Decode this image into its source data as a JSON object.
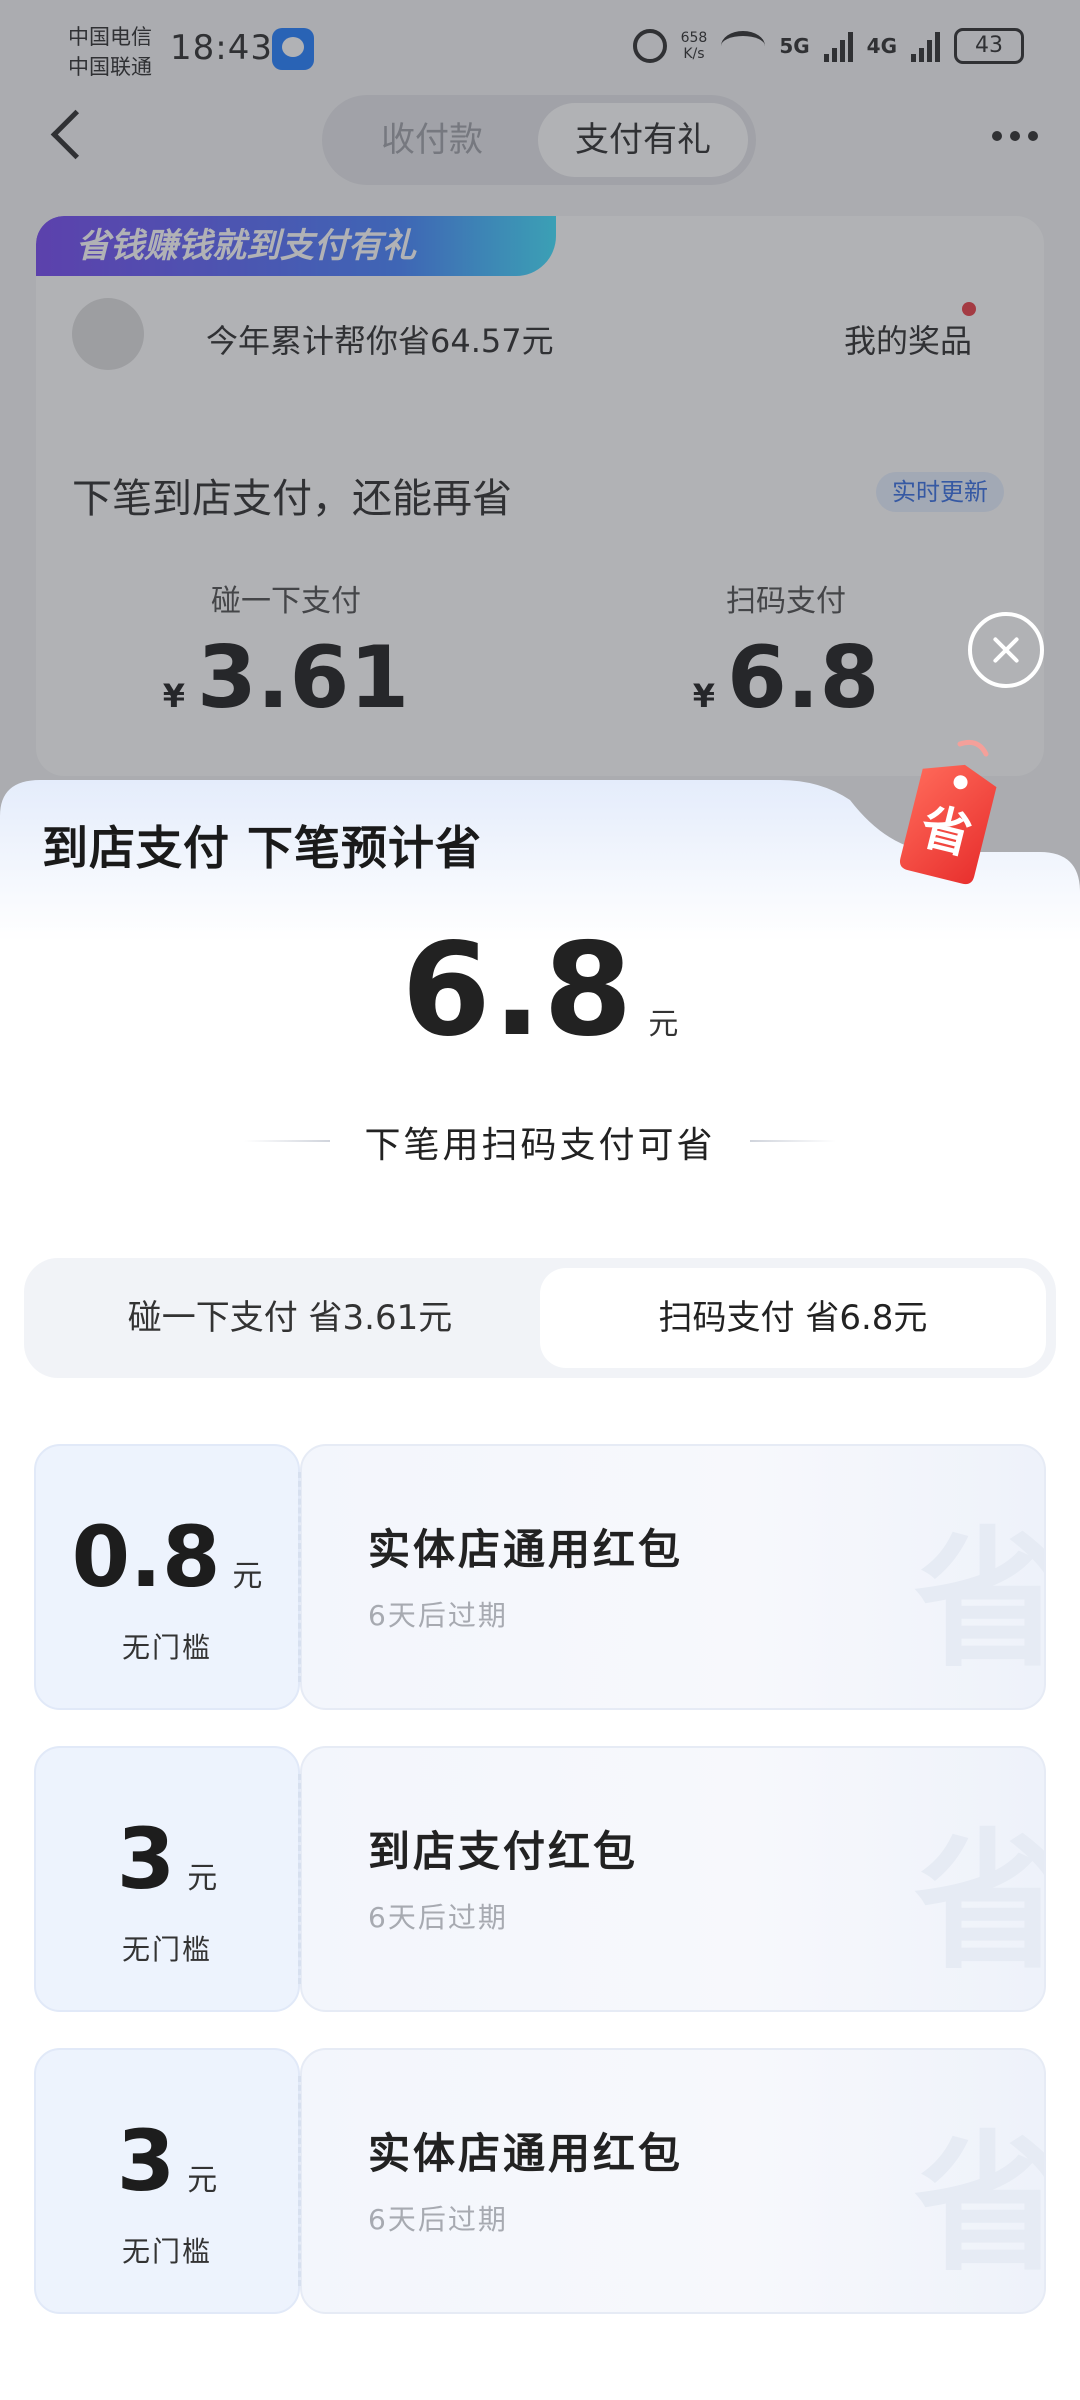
{
  "status_bar": {
    "carrier_1": "中国电信",
    "carrier_2": "中国联通",
    "time": "18:43",
    "net_speed_value": "658",
    "net_speed_unit": "K/s",
    "sig_5g": "5G",
    "sig_4g": "4G",
    "battery": "43"
  },
  "nav": {
    "tabs": [
      "收付款",
      "支付有礼"
    ],
    "active_tab": "支付有礼"
  },
  "promo": {
    "ribbon": "省钱赚钱就到支付有礼",
    "saved_text": "今年累计帮你省64.57元",
    "prize_link": "我的奖品",
    "next_title": "下笔到店支付，还能再省",
    "realtime_badge": "实时更新",
    "currency": "¥",
    "pay_options": [
      {
        "label": "碰一下支付",
        "amount": "3.61"
      },
      {
        "label": "扫码支付",
        "amount": "6.8"
      }
    ]
  },
  "sheet": {
    "title": "到店支付 下笔预计省",
    "tag_char": "省",
    "amount": "6.8",
    "amount_unit": "元",
    "caption": "下笔用扫码支付可省",
    "methods": [
      {
        "label": "碰一下支付 省3.61元"
      },
      {
        "label": "扫码支付 省6.8元"
      }
    ],
    "selected_method": "扫码支付 省6.8元",
    "coupons": [
      {
        "amount": "0.8",
        "unit": "元",
        "threshold": "无门槛",
        "name": "实体店通用红包",
        "expiry": "6天后过期"
      },
      {
        "amount": "3",
        "unit": "元",
        "threshold": "无门槛",
        "name": "到店支付红包",
        "expiry": "6天后过期"
      },
      {
        "amount": "3",
        "unit": "元",
        "threshold": "无门槛",
        "name": "实体店通用红包",
        "expiry": "6天后过期"
      }
    ],
    "watermark_char": "省"
  },
  "colors": {
    "accent_blue": "#2b66e0",
    "tag_red": "#f0463e",
    "coupon_bg": "#edf3fd",
    "sheet_header_tint": "#e6eefc"
  }
}
